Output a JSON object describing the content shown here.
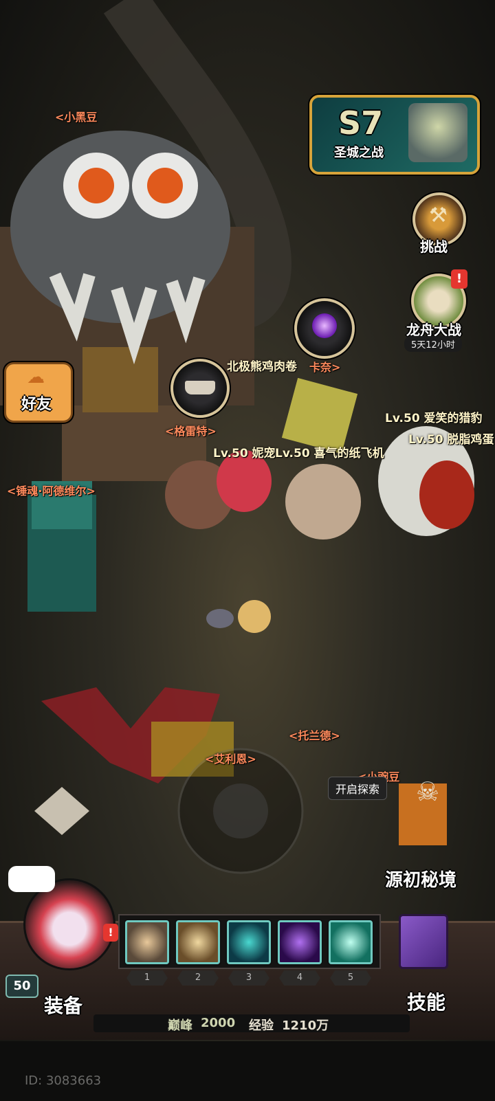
{
  "season": {
    "badge": "S7",
    "title": "圣城之战"
  },
  "buttons": {
    "challenge": "挑战",
    "dragon_boat": "龙舟大战",
    "dragon_boat_timer": "5天12小时",
    "friends": "好友",
    "explore": "开启探索",
    "origin_realm": "源初秘境",
    "equipment": "装备",
    "skills": "技能"
  },
  "npc_labels": {
    "xiaoheidou": "<小黑豆",
    "geleite": "<格雷特>",
    "kanai": "卡奈>",
    "chuihun": "<锤魂·阿德维尔>",
    "tuolande": "<托兰德>",
    "ailin": "<艾利恩>",
    "xiaodou": "<小豌豆"
  },
  "shop_items": {
    "bear_roll": "北极熊鸡肉卷"
  },
  "players": {
    "p1": "Lv.50 妮宠",
    "p2": "Lv.50 喜气的纸飞机",
    "p3": "Lv.50 爱笑的猎豹",
    "p4": "Lv.50 脱脂鸡蛋"
  },
  "player": {
    "level": "50",
    "id": "ID: 3083663"
  },
  "stats": {
    "peak_label": "巅峰",
    "peak_value": "2000",
    "exp_label": "经验",
    "exp_value": "1210万"
  },
  "skill_slots": [
    "1",
    "2",
    "3",
    "4",
    "5"
  ],
  "colors": {
    "npc_label": "#ff8a5c",
    "accent_gold": "#d6c49a",
    "skill_border": "#6fc9c0"
  }
}
